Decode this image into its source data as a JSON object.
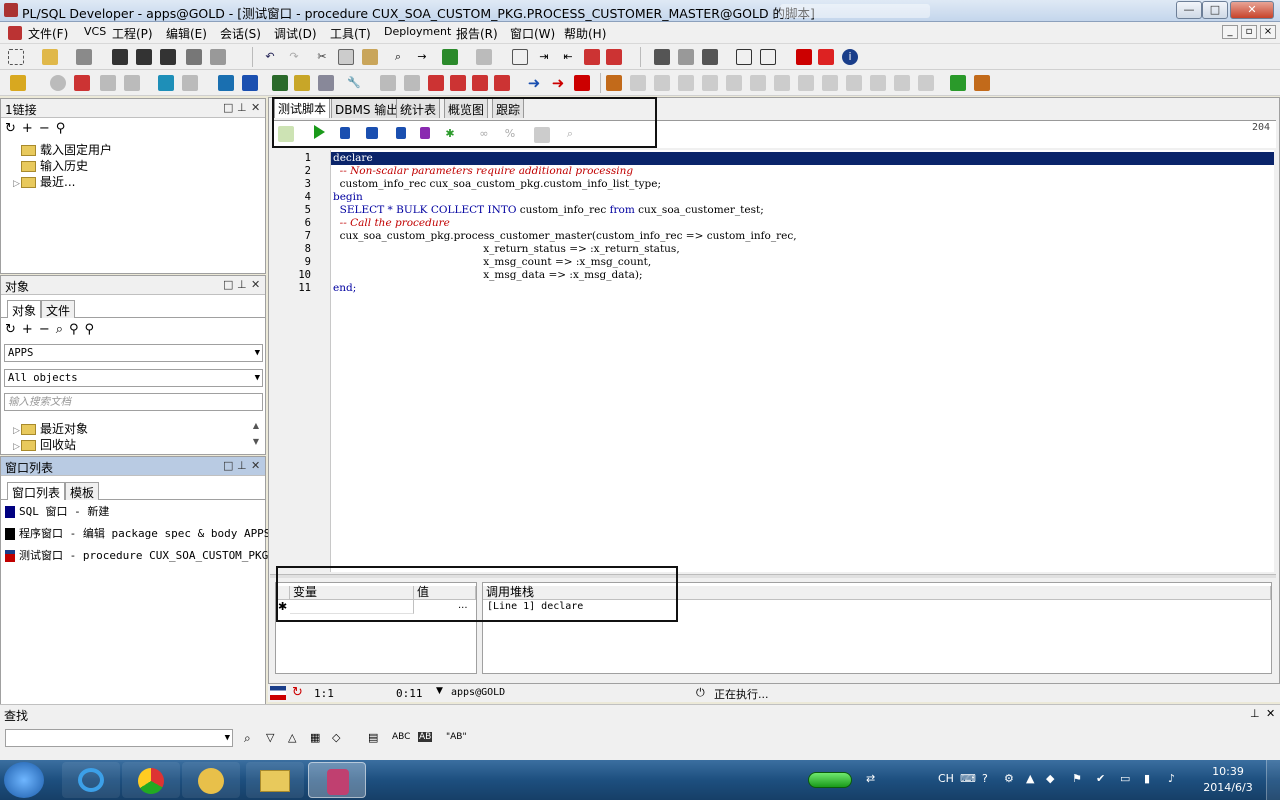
{
  "window": {
    "title": "PL/SQL Developer - apps@GOLD - [测试窗口 - procedure CUX_SOA_CUSTOM_PKG.PROCESS_CUSTOMER_MASTER@GOLD 的脚本]",
    "minimize": "—",
    "maximize": "□",
    "close": "✕"
  },
  "menu": [
    "文件(F)",
    "VCS",
    "工程(P)",
    "编辑(E)",
    "会话(S)",
    "调试(D)",
    "工具(T)",
    "Deployment",
    "报告(R)",
    "窗口(W)",
    "帮助(H)"
  ],
  "connections_panel": {
    "title": "1链接",
    "items": [
      "载入固定用户",
      "输入历史",
      "最近..."
    ]
  },
  "objects_panel": {
    "title": "对象",
    "tabs": [
      "对象",
      "文件"
    ],
    "owner": "APPS",
    "filter": "All objects",
    "search_placeholder": "输入搜索文档",
    "items": [
      "最近对象",
      "回收站"
    ]
  },
  "window_list_panel": {
    "title": "窗口列表",
    "tabs": [
      "窗口列表",
      "模板"
    ],
    "items": [
      {
        "label": "SQL 窗口 - 新建",
        "color": "#000080"
      },
      {
        "label": "程序窗口 - 编辑 package spec & body APPS.",
        "color": "#000000"
      },
      {
        "label": "测试窗口 - procedure CUX_SOA_CUSTOM_PKG.P",
        "color": "#c00000"
      }
    ]
  },
  "editor": {
    "tabs": [
      "测试脚本",
      "DBMS 输出",
      "统计表",
      "概览图",
      "跟踪"
    ],
    "column_indicator": "204",
    "line_numbers": [
      "1",
      "2",
      "3",
      "4",
      "5",
      "6",
      "7",
      "8",
      "9",
      "10",
      "11"
    ],
    "lines": {
      "l1": "declare",
      "l2": "  -- Non-scalar parameters require additional processing",
      "l3": "  custom_info_rec cux_soa_custom_pkg.custom_info_list_type;",
      "l4": "begin",
      "l5a": "  SELECT * BULK COLLECT INTO",
      "l5b": " custom_info_rec ",
      "l5c": "from",
      "l5d": " cux_soa_customer_test;",
      "l6": "  -- Call the procedure",
      "l7": "  cux_soa_custom_pkg.process_customer_master(custom_info_rec => custom_info_rec,",
      "l8": "                                             x_return_status => :x_return_status,",
      "l9": "                                             x_msg_count => :x_msg_count,",
      "l10": "                                             x_msg_data => :x_msg_data);",
      "l11": "end;"
    }
  },
  "variables": {
    "col_var": "变量",
    "col_val": "值",
    "row_marker": "✱",
    "ellipsis": "..."
  },
  "call_stack": {
    "header": "调用堆栈",
    "row": "[Line 1] declare"
  },
  "status": {
    "cursor": "1:1",
    "time": "0:11",
    "connection": "apps@GOLD",
    "state": "正在执行..."
  },
  "find": {
    "title": "查找",
    "buttons": [
      "ABC",
      "\"AB\""
    ]
  },
  "taskbar": {
    "lang": "CH",
    "time": "10:39",
    "date": "2014/6/3"
  },
  "colors": {
    "selection": "#0a246a",
    "keyword": "#0000a0",
    "comment": "#c00000"
  }
}
